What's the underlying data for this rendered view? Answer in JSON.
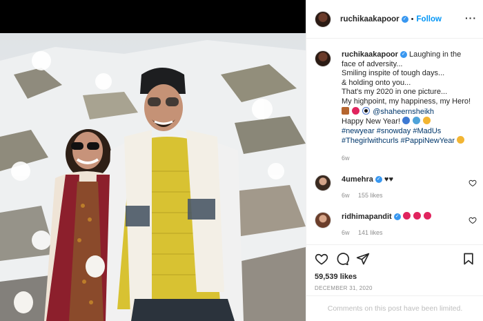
{
  "post": {
    "username": "ruchikaakapoor",
    "follow_label": "Follow",
    "dot": "•",
    "more_label": "···"
  },
  "caption": {
    "username": "ruchikaakapoor",
    "lines": [
      "Laughing in the face of adversity...",
      "Smiling inspite of tough days...",
      "& holding onto you...",
      "That's my 2020 in one picture...",
      "My highpoint, my happiness, my Hero!"
    ],
    "mention": "@shaheernsheikh",
    "new_year_line": "Happy New Year!",
    "hashtags_1": "#newyear #snowday #MadUs",
    "hashtags_2": "#Thegirlwithcurls #PappiNewYear",
    "age": "6w"
  },
  "comments": [
    {
      "username": "4umehra",
      "text": "♥♥",
      "age": "6w",
      "likes": "155 likes"
    },
    {
      "username": "ridhimapandit",
      "text": "",
      "age": "6w",
      "likes": "141 likes"
    }
  ],
  "stats": {
    "likes": "59,539 likes",
    "date": "DECEMBER 31, 2020",
    "comments_limited": "Comments on this post have been limited."
  },
  "colors": {
    "accent": "#0095f6",
    "verified": "#3897f0",
    "heart_red": "#ed4956"
  }
}
